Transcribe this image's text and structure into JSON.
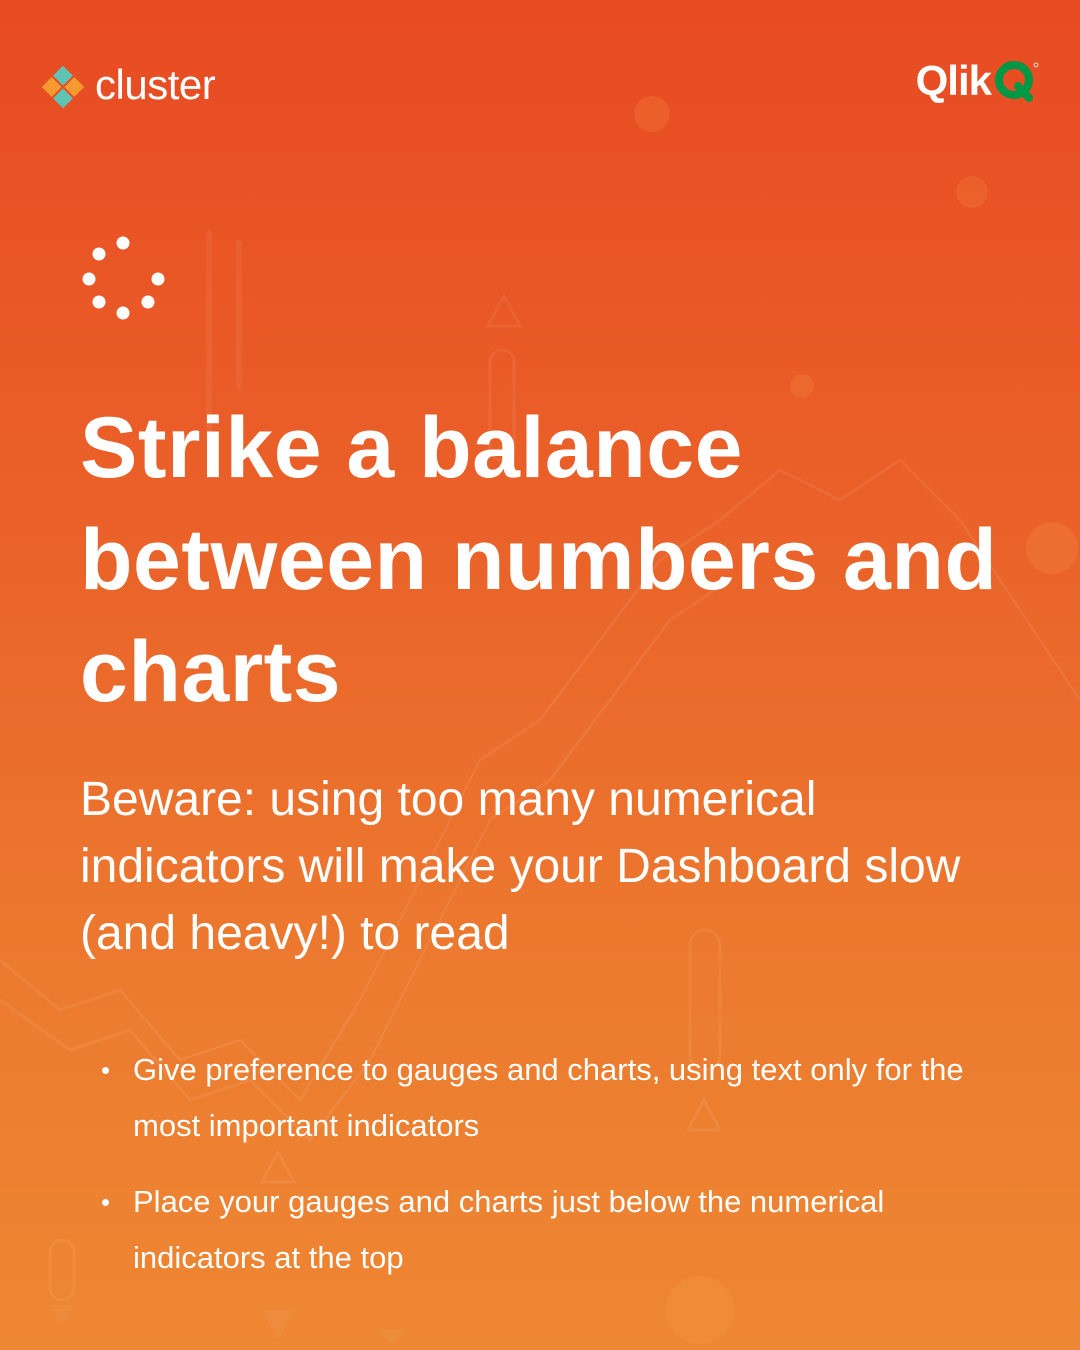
{
  "brand": {
    "cluster_name": "cluster",
    "cluster_logo_icon": "cluster-diamond-logo",
    "qlik_name": "Qlik",
    "qlik_logo_icon": "qlik-q-logo"
  },
  "decor": {
    "loader_icon": "dotted-loader-icon"
  },
  "content": {
    "headline": "Strike a balance between numbers and charts",
    "subhead": "Beware: using too many numerical indicators will make your Dashboard slow (and heavy!) to read",
    "bullets": [
      "Give preference to gauges and charts, using text only for the most important indicators",
      "Place your gauges and charts just below the numerical indicators at the top"
    ]
  },
  "colors": {
    "background_top": "#e84a22",
    "background_bottom": "#ee8733",
    "text": "#ffffff",
    "cluster_teal": "#5fc4b4",
    "cluster_orange": "#f59a2e",
    "qlik_green": "#009845"
  }
}
